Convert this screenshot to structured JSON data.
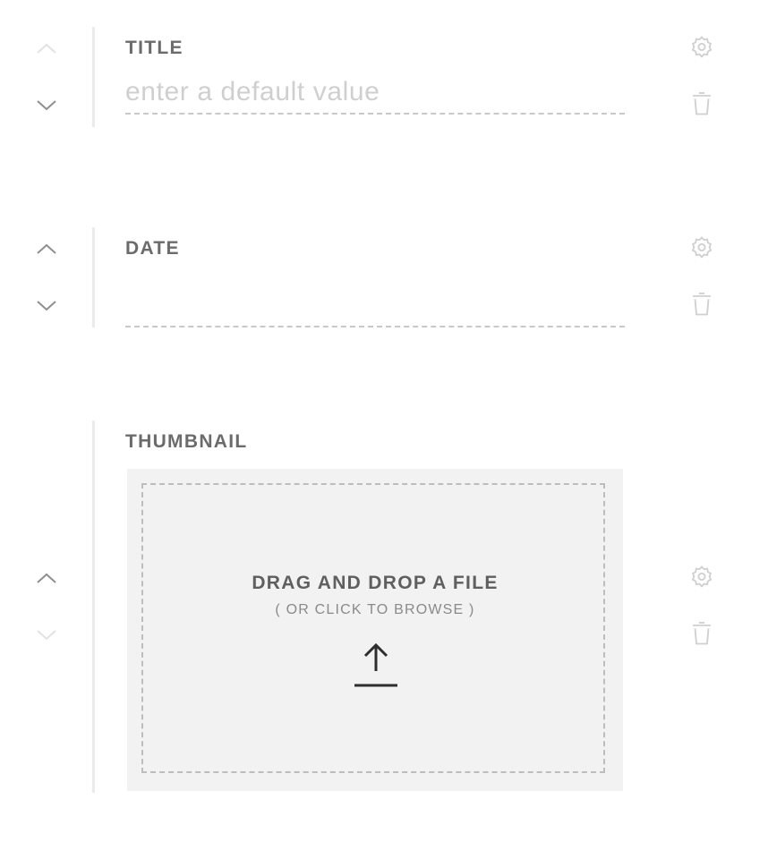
{
  "fields": [
    {
      "label": "TITLE",
      "placeholder": "enter a default value",
      "value": "",
      "move_up_enabled": false,
      "move_down_enabled": true
    },
    {
      "label": "DATE",
      "placeholder": "",
      "value": "",
      "move_up_enabled": true,
      "move_down_enabled": true
    },
    {
      "label": "THUMBNAIL",
      "move_up_enabled": true,
      "move_down_enabled": false,
      "dropzone": {
        "title": "DRAG AND DROP A FILE",
        "subtitle": "( OR CLICK TO BROWSE )",
        "icon": "upload-arrow-icon"
      }
    }
  ],
  "icons": {
    "move_up": "chevron-up-icon",
    "move_down": "chevron-down-icon",
    "settings": "gear-icon",
    "delete": "trash-icon"
  },
  "colors": {
    "rail": "#ebebeb",
    "label": "#6b6b6b",
    "icon": "#cfcfcf",
    "arrow_enabled": "#8f8f8f",
    "arrow_disabled": "#e2e2e2",
    "dropzone_bg": "#f2f2f2",
    "dropzone_border": "#bdbdbd"
  }
}
